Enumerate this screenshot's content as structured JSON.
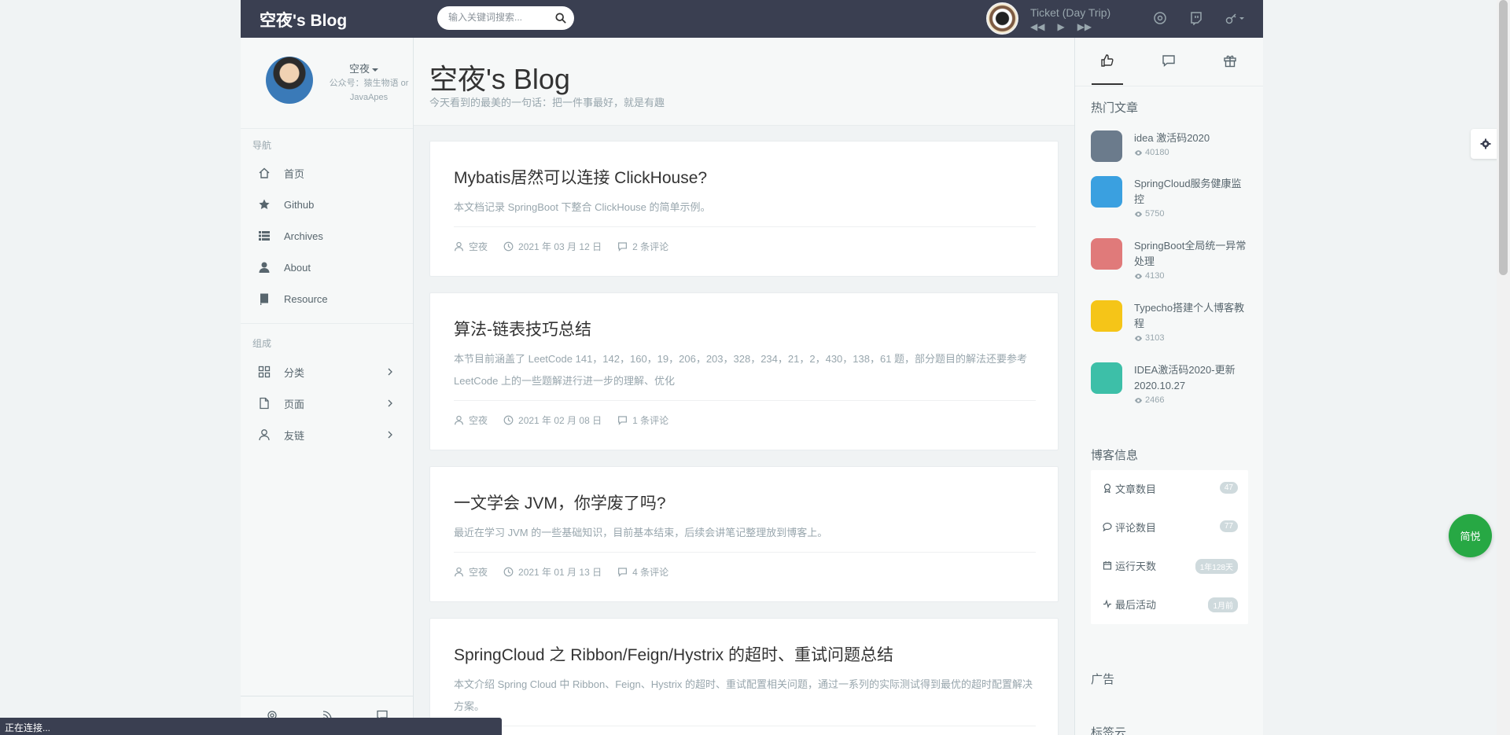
{
  "header": {
    "brand": "空夜's Blog",
    "search_placeholder": "输入关键词搜索...",
    "player": {
      "title": "Ticket (Day Trip)"
    }
  },
  "aside": {
    "user": {
      "name": "空夜",
      "desc": "公众号：猿生物语 or JavaApes"
    },
    "nav_title": "导航",
    "nav": [
      {
        "label": "首页",
        "icon": "home-icon"
      },
      {
        "label": "Github",
        "icon": "star-icon"
      },
      {
        "label": "Archives",
        "icon": "list-icon"
      },
      {
        "label": "About",
        "icon": "user-icon"
      },
      {
        "label": "Resource",
        "icon": "book-icon"
      }
    ],
    "group_title": "组成",
    "groups": [
      {
        "label": "分类",
        "icon": "grid-icon"
      },
      {
        "label": "页面",
        "icon": "file-icon"
      },
      {
        "label": "友链",
        "icon": "user-outline-icon"
      }
    ]
  },
  "main": {
    "title": "空夜's Blog",
    "subtitle": "今天看到的最美的一句话：把一件事最好，就是有趣",
    "posts": [
      {
        "title": "Mybatis居然可以连接 ClickHouse?",
        "desc": "本文档记录 SpringBoot 下整合 ClickHouse 的简单示例。",
        "author": "空夜",
        "date": "2021 年 03 月 12 日",
        "comments": "2 条评论"
      },
      {
        "title": "算法-链表技巧总结",
        "desc": "本节目前涵盖了 LeetCode 141，142，160，19，206，203，328，234，21，2，430，138，61 题，部分题目的解法还要参考 LeetCode 上的一些题解进行进一步的理解、优化",
        "author": "空夜",
        "date": "2021 年 02 月 08 日",
        "comments": "1 条评论"
      },
      {
        "title": "一文学会 JVM，你学废了吗?",
        "desc": "最近在学习 JVM 的一些基础知识，目前基本结束，后续会讲笔记整理放到博客上。",
        "author": "空夜",
        "date": "2021 年 01 月 13 日",
        "comments": "4 条评论"
      },
      {
        "title": "SpringCloud 之 Ribbon/Feign/Hystrix 的超时、重试问题总结",
        "desc": "本文介绍 Spring Cloud 中 Ribbon、Feign、Hystrix 的超时、重试配置相关问题，通过一系列的实际测试得到最优的超时配置解决方案。"
      }
    ]
  },
  "right": {
    "hot_title": "热门文章",
    "hot": [
      {
        "title": "idea 激活码2020",
        "views": "40180",
        "color": "#6b7b8c"
      },
      {
        "title": "SpringCloud服务健康监控",
        "views": "5750",
        "color": "#3aa0e0"
      },
      {
        "title": "SpringBoot全局统一异常处理",
        "views": "4130",
        "color": "#e07a7a"
      },
      {
        "title": "Typecho搭建个人博客教程",
        "views": "3103",
        "color": "#f5c518"
      },
      {
        "title": "IDEA激活码2020-更新2020.10.27",
        "views": "2466",
        "color": "#3dbfa8"
      }
    ],
    "info_title": "博客信息",
    "info": [
      {
        "label": "文章数目",
        "value": "47",
        "icon": "medal-icon"
      },
      {
        "label": "评论数目",
        "value": "77",
        "icon": "comment-icon"
      },
      {
        "label": "运行天数",
        "value": "1年128天",
        "icon": "calendar-icon"
      },
      {
        "label": "最后活动",
        "value": "1月前",
        "icon": "activity-icon"
      }
    ],
    "ad_title": "广告",
    "tags_title": "标签云"
  },
  "float": {
    "jianyue": "简悦"
  },
  "status": "正在连接..."
}
